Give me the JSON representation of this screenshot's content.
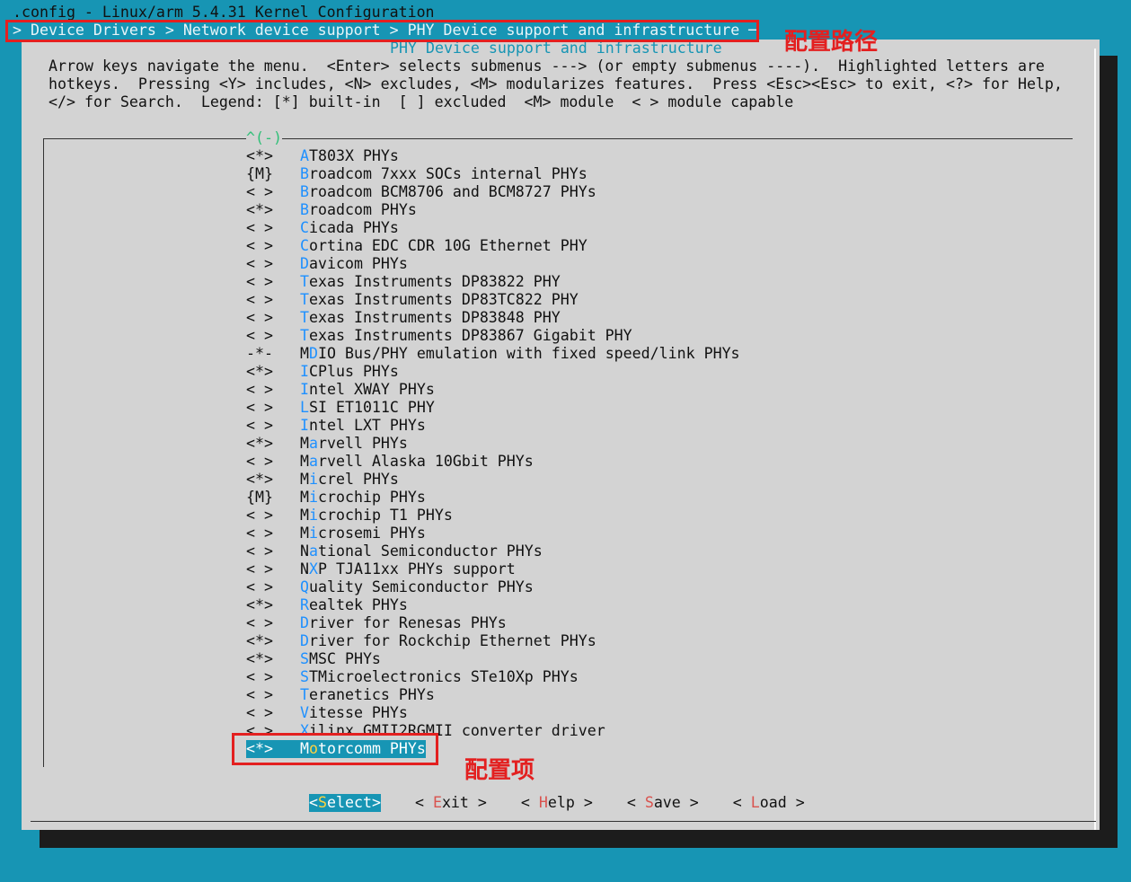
{
  "window": {
    "title_line": ".config - Linux/arm 5.4.31 Kernel Configuration",
    "path_line": "> Device Drivers > Network device support > PHY Device support and infrastructure ─"
  },
  "annotations": {
    "path_label": "配置路径",
    "item_label": "配置项"
  },
  "dialog": {
    "title": "PHY Device support and infrastructure",
    "help_lines": [
      "Arrow keys navigate the menu.  <Enter> selects submenus ---> (or empty submenus ----).  Highlighted letters are",
      "hotkeys.  Pressing <Y> includes, <N> excludes, <M> modularizes features.  Press <Esc><Esc> to exit, <?> for Help,",
      "</> for Search.  Legend: [*] built-in  [ ] excluded  <M> module  < > module capable"
    ],
    "scroll_indicator": "^(-)"
  },
  "menu": {
    "items": [
      {
        "state": "<*>",
        "hotkey": "A",
        "rest": "T803X PHYs"
      },
      {
        "state": "{M}",
        "hotkey": "B",
        "rest": "roadcom 7xxx SOCs internal PHYs"
      },
      {
        "state": "< >",
        "hotkey": "B",
        "rest": "roadcom BCM8706 and BCM8727 PHYs"
      },
      {
        "state": "<*>",
        "hotkey": "B",
        "rest": "roadcom PHYs"
      },
      {
        "state": "< >",
        "hotkey": "C",
        "rest": "icada PHYs"
      },
      {
        "state": "< >",
        "hotkey": "C",
        "rest": "ortina EDC CDR 10G Ethernet PHY"
      },
      {
        "state": "< >",
        "hotkey": "D",
        "rest": "avicom PHYs"
      },
      {
        "state": "< >",
        "hotkey": "T",
        "rest": "exas Instruments DP83822 PHY"
      },
      {
        "state": "< >",
        "hotkey": "T",
        "rest": "exas Instruments DP83TC822 PHY"
      },
      {
        "state": "< >",
        "hotkey": "T",
        "rest": "exas Instruments DP83848 PHY"
      },
      {
        "state": "< >",
        "hotkey": "T",
        "rest": "exas Instruments DP83867 Gigabit PHY"
      },
      {
        "state": "-*-",
        "pre": "M",
        "hotkey": "D",
        "rest": "IO Bus/PHY emulation with fixed speed/link PHYs"
      },
      {
        "state": "<*>",
        "hotkey": "I",
        "rest": "CPlus PHYs"
      },
      {
        "state": "< >",
        "hotkey": "I",
        "rest": "ntel XWAY PHYs"
      },
      {
        "state": "< >",
        "hotkey": "L",
        "rest": "SI ET1011C PHY"
      },
      {
        "state": "< >",
        "hotkey": "I",
        "rest": "ntel LXT PHYs"
      },
      {
        "state": "<*>",
        "pre": "M",
        "hotkey": "a",
        "rest": "rvell PHYs"
      },
      {
        "state": "< >",
        "pre": "M",
        "hotkey": "a",
        "rest": "rvell Alaska 10Gbit PHYs"
      },
      {
        "state": "<*>",
        "pre": "M",
        "hotkey": "i",
        "rest": "crel PHYs"
      },
      {
        "state": "{M}",
        "pre": "M",
        "hotkey": "i",
        "rest": "crochip PHYs"
      },
      {
        "state": "< >",
        "pre": "M",
        "hotkey": "i",
        "rest": "crochip T1 PHYs"
      },
      {
        "state": "< >",
        "pre": "M",
        "hotkey": "i",
        "rest": "crosemi PHYs"
      },
      {
        "state": "< >",
        "pre": "N",
        "hotkey": "a",
        "rest": "tional Semiconductor PHYs"
      },
      {
        "state": "< >",
        "pre": "N",
        "hotkey": "X",
        "rest": "P TJA11xx PHYs support"
      },
      {
        "state": "< >",
        "hotkey": "Q",
        "rest": "uality Semiconductor PHYs"
      },
      {
        "state": "<*>",
        "hotkey": "R",
        "rest": "ealtek PHYs"
      },
      {
        "state": "< >",
        "hotkey": "D",
        "rest": "river for Renesas PHYs"
      },
      {
        "state": "<*>",
        "hotkey": "D",
        "rest": "river for Rockchip Ethernet PHYs"
      },
      {
        "state": "<*>",
        "hotkey": "S",
        "rest": "MSC PHYs"
      },
      {
        "state": "< >",
        "hotkey": "S",
        "rest": "TMicroelectronics STe10Xp PHYs"
      },
      {
        "state": "< >",
        "hotkey": "T",
        "rest": "eranetics PHYs"
      },
      {
        "state": "< >",
        "hotkey": "V",
        "rest": "itesse PHYs"
      },
      {
        "state": "< >",
        "hotkey": "X",
        "rest": "ilinx GMII2RGMII converter driver"
      },
      {
        "state": "<*>",
        "pre": "M",
        "hotkey": "o",
        "rest": "torcomm PHYs",
        "selected": true
      }
    ]
  },
  "buttons": [
    {
      "pre": "<",
      "hotkey": "S",
      "rest": "elect>",
      "active": true
    },
    {
      "pre": "< ",
      "hotkey": "E",
      "rest": "xit >"
    },
    {
      "pre": "< ",
      "hotkey": "H",
      "rest": "elp >"
    },
    {
      "pre": "< ",
      "hotkey": "S",
      "rest": "ave >"
    },
    {
      "pre": "< ",
      "hotkey": "L",
      "rest": "oad >"
    }
  ],
  "colors": {
    "terminal_bg": "#1795b4",
    "dialog_bg": "#d3d3d3",
    "hotkey": "#1e90ff",
    "annotation_red": "#e32020"
  }
}
